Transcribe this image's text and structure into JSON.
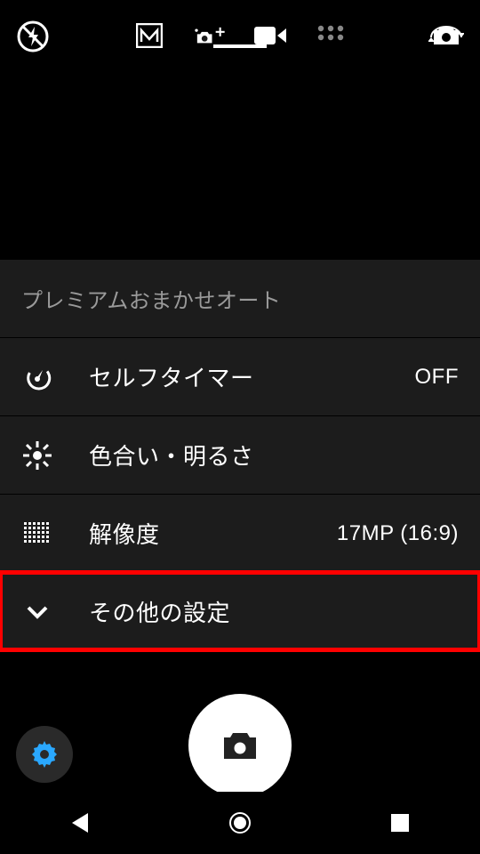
{
  "topbar": {
    "flash": "off",
    "modes": [
      "manual",
      "superior-auto",
      "video",
      "apps"
    ],
    "selected_mode": "superior-auto"
  },
  "panel": {
    "title": "プレミアムおまかせオート",
    "rows": [
      {
        "icon": "timer-icon",
        "label": "セルフタイマー",
        "value": "OFF"
      },
      {
        "icon": "brightness-icon",
        "label": "色合い・明るさ",
        "value": ""
      },
      {
        "icon": "resolution-icon",
        "label": "解像度",
        "value": "17MP (16:9)"
      },
      {
        "icon": "chevron-down-icon",
        "label": "その他の設定",
        "value": "",
        "highlighted": true
      }
    ]
  },
  "bottom": {
    "settings_icon": "gear-icon",
    "shutter_icon": "camera-icon"
  },
  "navbar": {
    "buttons": [
      "back",
      "home",
      "recent"
    ]
  },
  "colors": {
    "background": "#000000",
    "panel": "#1c1c1c",
    "text": "#ffffff",
    "subtext": "#9a9a9a",
    "highlight": "#ff0000",
    "accent": "#2aa8ff"
  }
}
